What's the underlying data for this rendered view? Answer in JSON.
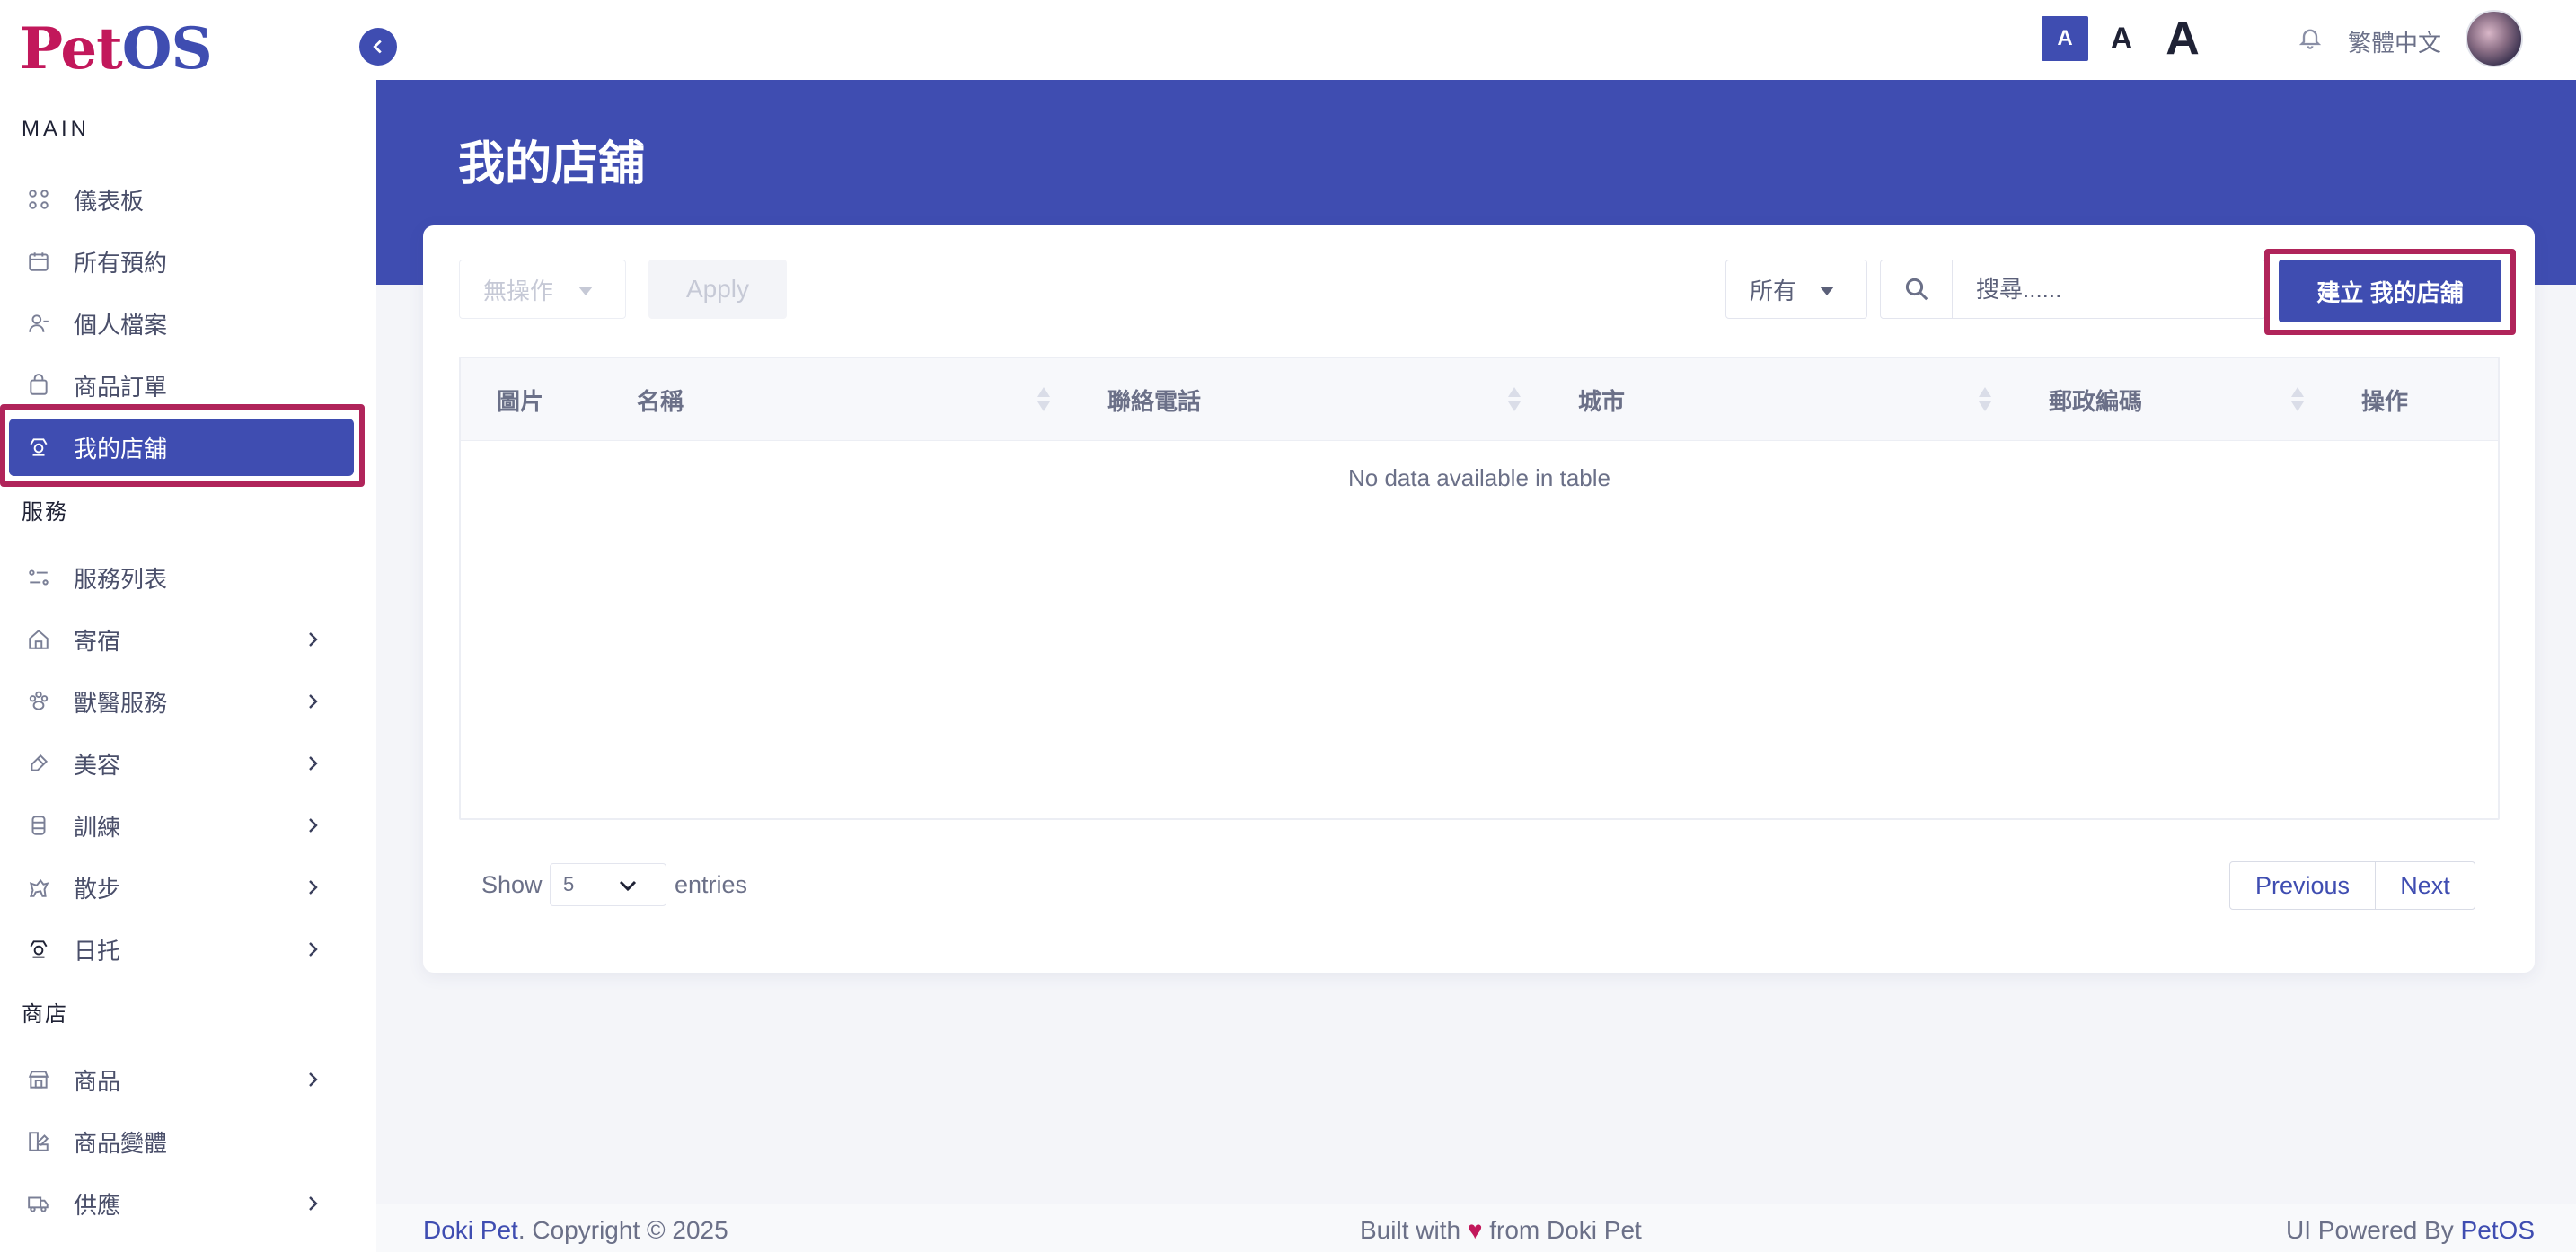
{
  "app": {
    "logo_p": "Pet",
    "logo_os": "OS"
  },
  "sidebar": {
    "sections": {
      "main": "MAIN",
      "services": "服務",
      "shop": "商店"
    },
    "items": [
      {
        "label": "儀表板",
        "icon": "dashboard-icon"
      },
      {
        "label": "所有預約",
        "icon": "calendar-icon"
      },
      {
        "label": "個人檔案",
        "icon": "user-icon"
      },
      {
        "label": "商品訂單",
        "icon": "bag-icon"
      },
      {
        "label": "我的店舖",
        "icon": "store-icon",
        "active": true
      },
      {
        "label": "服務列表",
        "icon": "list-icon"
      },
      {
        "label": "寄宿",
        "icon": "home-icon",
        "has_submenu": true
      },
      {
        "label": "獸醫服務",
        "icon": "paw-icon",
        "has_submenu": true
      },
      {
        "label": "美容",
        "icon": "brush-icon",
        "has_submenu": true
      },
      {
        "label": "訓練",
        "icon": "training-icon",
        "has_submenu": true
      },
      {
        "label": "散步",
        "icon": "walk-icon",
        "has_submenu": true
      },
      {
        "label": "日托",
        "icon": "daycare-icon",
        "has_submenu": true
      },
      {
        "label": "商品",
        "icon": "shop-icon",
        "has_submenu": true
      },
      {
        "label": "商品變體",
        "icon": "variant-icon"
      },
      {
        "label": "供應",
        "icon": "truck-icon",
        "has_submenu": true
      }
    ]
  },
  "topbar": {
    "font_sizes": [
      "A",
      "A",
      "A"
    ],
    "language": "繁體中文"
  },
  "page": {
    "title": "我的店舖"
  },
  "toolbar": {
    "bulk_action": "無操作",
    "apply": "Apply",
    "filter": "所有",
    "search_placeholder": "搜尋......",
    "create": "建立 我的店舖"
  },
  "table": {
    "columns": [
      "圖片",
      "名稱",
      "聯絡電話",
      "城市",
      "郵政編碼",
      "操作"
    ],
    "empty_message": "No data available in table"
  },
  "pagination": {
    "show": "Show",
    "page_size": "5",
    "entries": "entries",
    "previous": "Previous",
    "next": "Next"
  },
  "footer": {
    "brand": "Doki Pet",
    "copyright": ". Copyright © 2025",
    "built_prefix": "Built with",
    "built_suffix": "from Doki Pet",
    "powered_prefix": "UI Powered By",
    "powered_brand": "PetOS"
  },
  "colors": {
    "primary": "#3f4db1",
    "highlight": "#b0245a",
    "brand_red": "#c2185b"
  }
}
